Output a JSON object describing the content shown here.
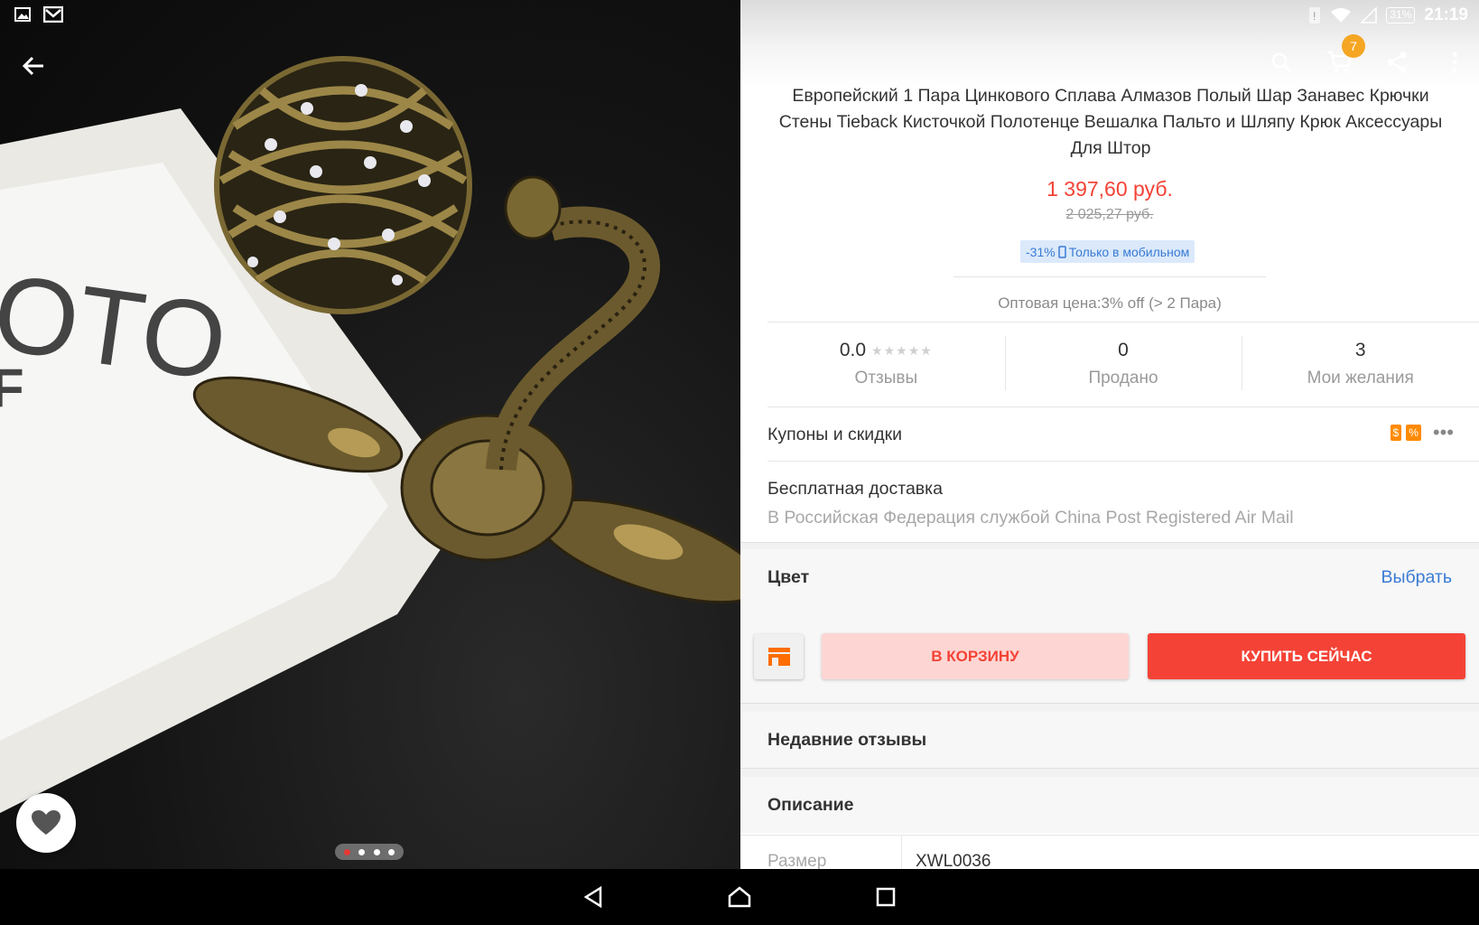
{
  "status_bar": {
    "left_icons": [
      "gallery-icon",
      "mail-icon"
    ],
    "battery": "31%",
    "time": "21:19"
  },
  "image_gallery": {
    "photo_text": [
      "OTO",
      "F"
    ],
    "page_count": 4,
    "active_page": 1
  },
  "header": {
    "icons": [
      "search-icon",
      "cart-icon",
      "share-icon",
      "more-vert-icon"
    ],
    "cart_count": "7"
  },
  "product": {
    "title": "Европейский 1 Пара Цинкового Сплава Алмазов Полый Шар Занавес Крючки Стены Tieback Кисточкой Полотенце Вешалка Пальто и Шляпу Крюк Аксессуары Для Штор",
    "price": "1 397,60 руб.",
    "old_price": "2 025,27 руб.",
    "promo_discount": "-31%",
    "promo_text": "Только в мобильном",
    "wholesale": "Оптовая цена:3% off (> 2 Пара)"
  },
  "stats": [
    {
      "value": "0.0",
      "label": "Отзывы",
      "stars": "★★★★★"
    },
    {
      "value": "0",
      "label": "Продано"
    },
    {
      "value": "3",
      "label": "Мои желания"
    }
  ],
  "coupons": {
    "label": "Купоны и скидки",
    "icon_a": "$",
    "icon_b": "%"
  },
  "shipping": {
    "title": "Бесплатная доставка",
    "detail": "В Российская Федерация службой China Post Registered Air Mail"
  },
  "color": {
    "label": "Цвет",
    "action": "Выбрать"
  },
  "buttons": {
    "add_to_cart": "В КОРЗИНУ",
    "buy_now": "КУПИТЬ СЕЙЧАС"
  },
  "sections": {
    "reviews": "Недавние отзывы",
    "description": "Описание"
  },
  "spec": {
    "key": "Размер",
    "value": "XWL0036"
  },
  "colors": {
    "accent_red": "#f44336",
    "link_blue": "#3a7bd5",
    "badge_orange": "#f5a623"
  }
}
